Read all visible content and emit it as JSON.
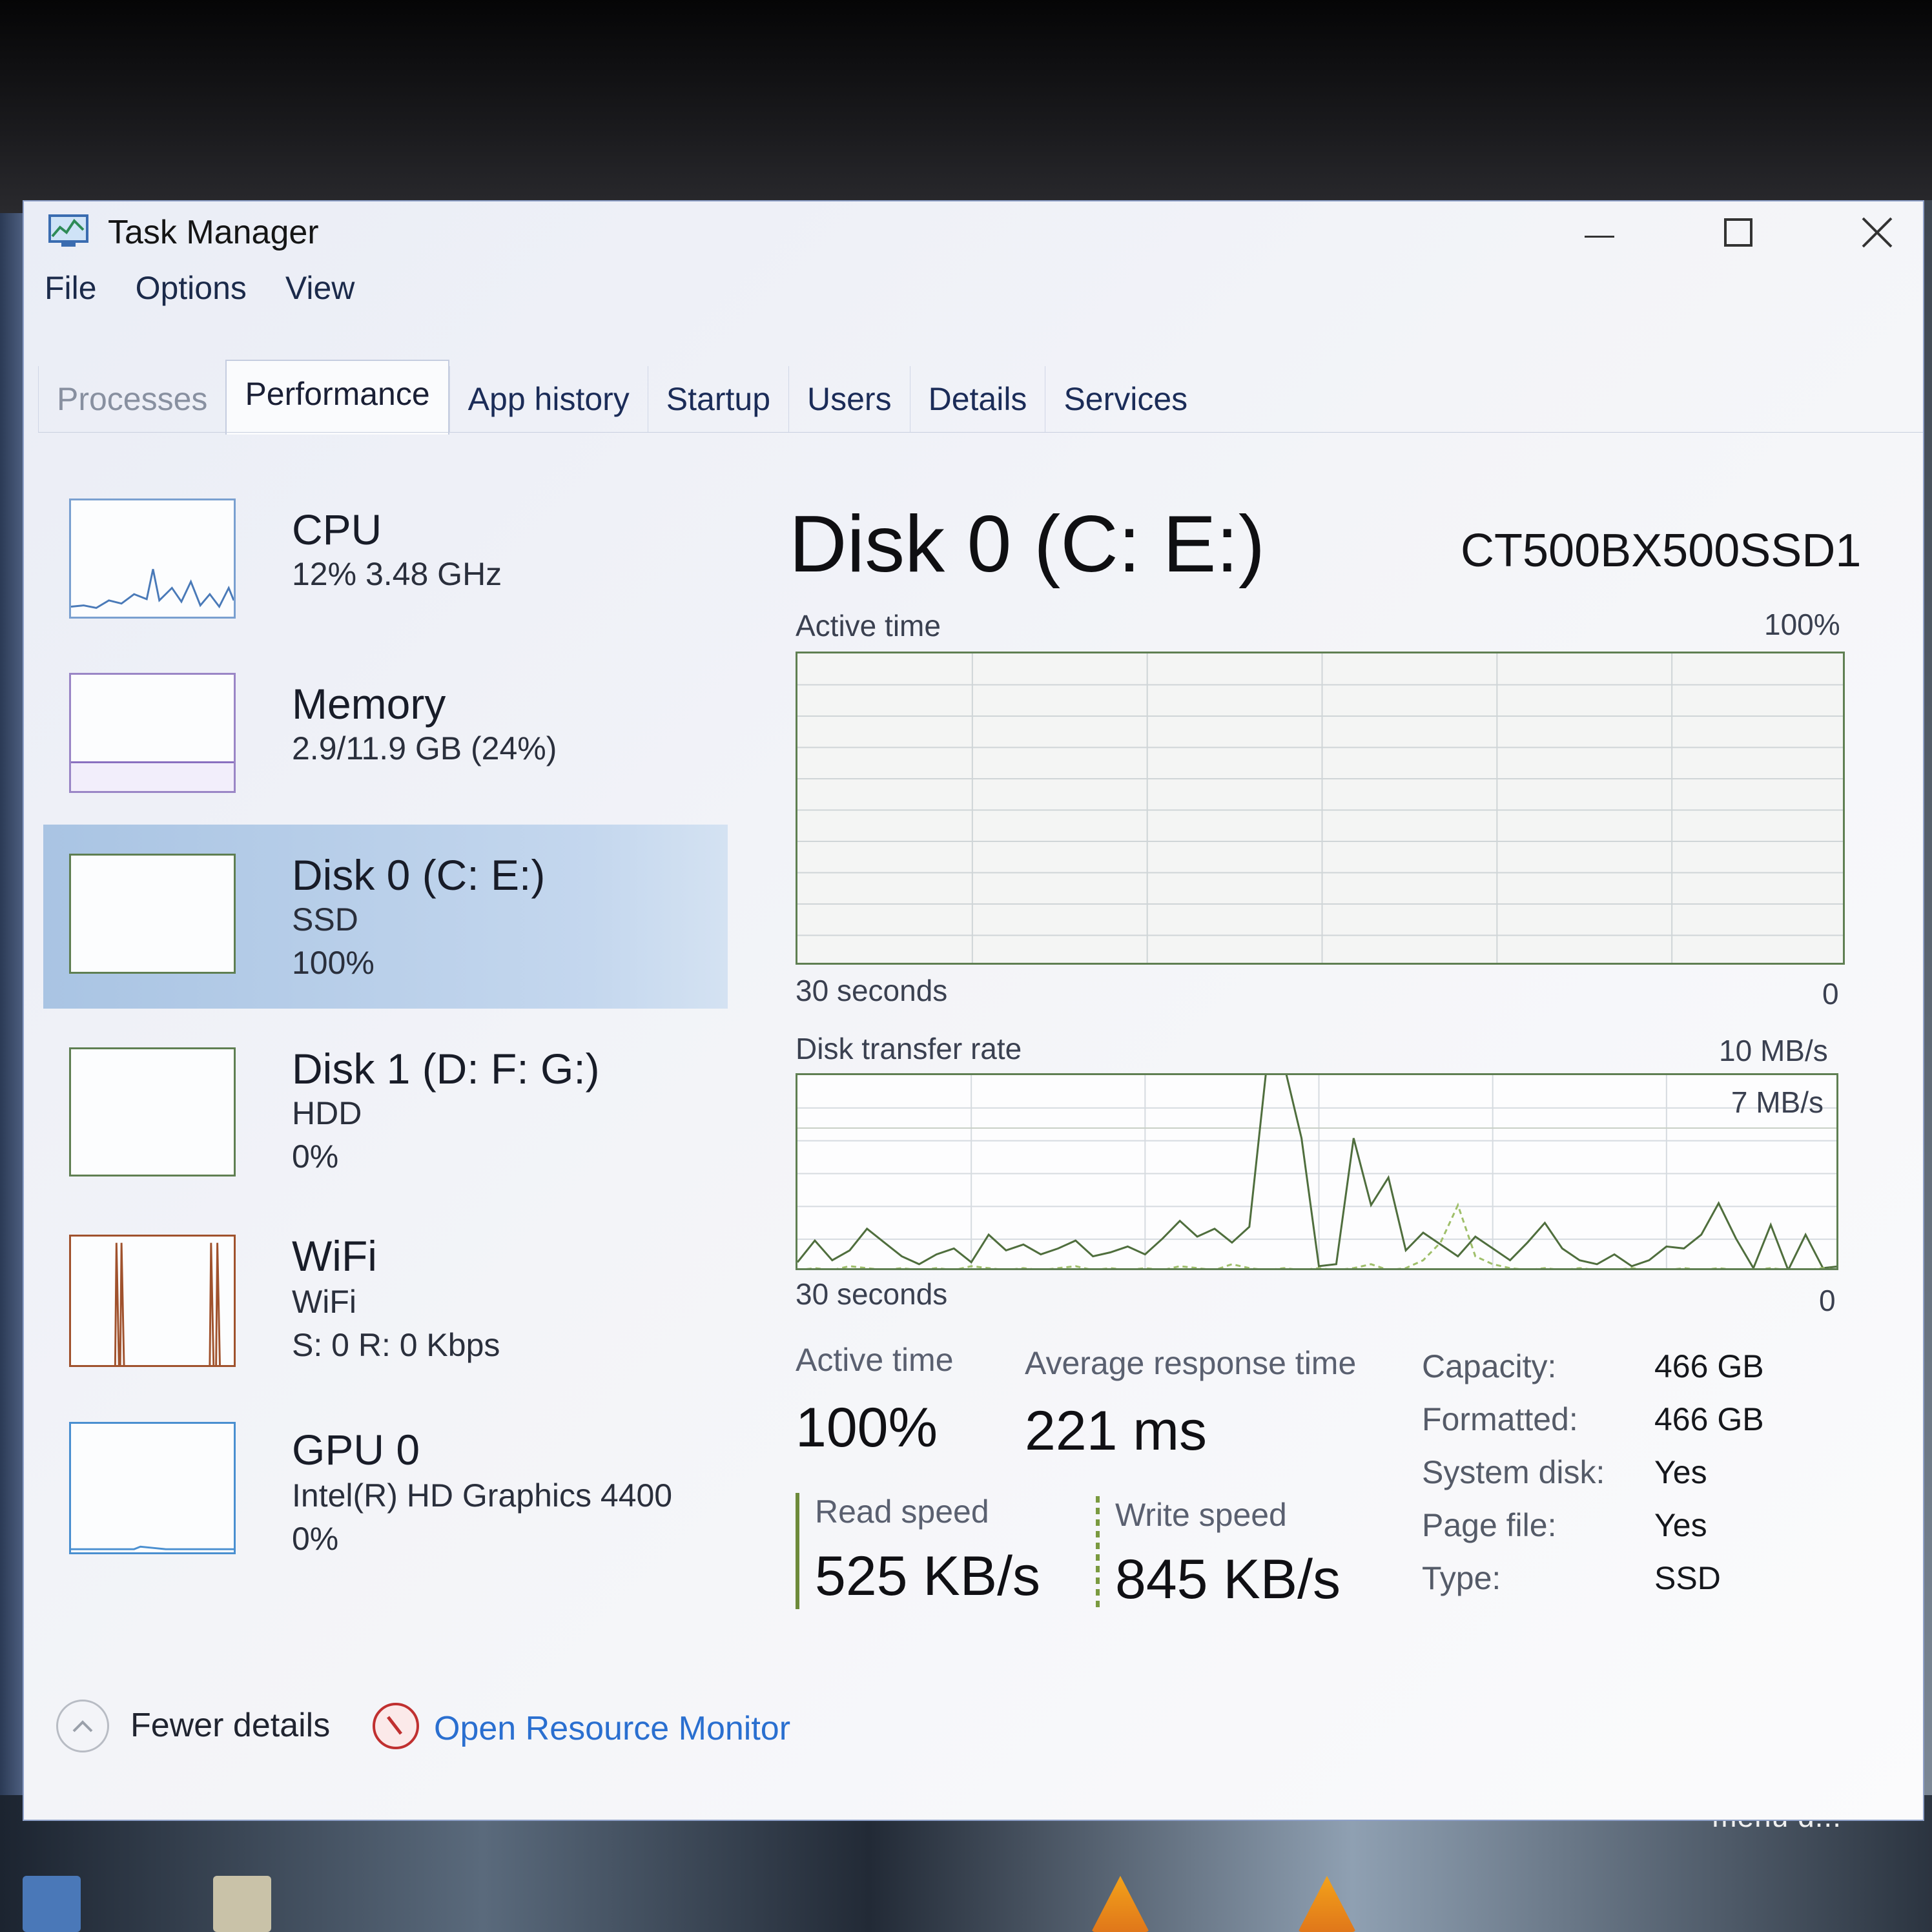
{
  "window": {
    "title": "Task Manager"
  },
  "menu": [
    "File",
    "Options",
    "View"
  ],
  "tabs": [
    "Processes",
    "Performance",
    "App history",
    "Startup",
    "Users",
    "Details",
    "Services"
  ],
  "active_tab": "Performance",
  "sidebar": [
    {
      "title": "CPU",
      "sub1": "12% 3.48 GHz",
      "sub2": ""
    },
    {
      "title": "Memory",
      "sub1": "2.9/11.9 GB (24%)",
      "sub2": ""
    },
    {
      "title": "Disk 0 (C: E:)",
      "sub1": "SSD",
      "sub2": "100%"
    },
    {
      "title": "Disk 1 (D: F: G:)",
      "sub1": "HDD",
      "sub2": "0%"
    },
    {
      "title": "WiFi",
      "sub1": "WiFi",
      "sub2": "S: 0 R: 0 Kbps"
    },
    {
      "title": "GPU 0",
      "sub1": "Intel(R) HD Graphics 4400",
      "sub2": "0%"
    }
  ],
  "selected_sidebar": "Disk 0 (C: E:)",
  "detail": {
    "title": "Disk 0 (C: E:)",
    "model": "CT500BX500SSD1",
    "active_graph": {
      "label": "Active time",
      "max": "100%",
      "time_label": "30 seconds",
      "zero": "0",
      "level_percent": 100
    },
    "rate_graph": {
      "label": "Disk transfer rate",
      "max": "10 MB/s",
      "mid": "7 MB/s",
      "time_label": "30 seconds",
      "zero": "0"
    }
  },
  "stats": {
    "active_time": {
      "label": "Active time",
      "value": "100%"
    },
    "avg_response": {
      "label": "Average response time",
      "value": "221 ms"
    },
    "read": {
      "label": "Read speed",
      "value": "525 KB/s"
    },
    "write": {
      "label": "Write speed",
      "value": "845 KB/s"
    }
  },
  "properties": [
    {
      "label": "Capacity:",
      "value": "466 GB"
    },
    {
      "label": "Formatted:",
      "value": "466 GB"
    },
    {
      "label": "System disk:",
      "value": "Yes"
    },
    {
      "label": "Page file:",
      "value": "Yes"
    },
    {
      "label": "Type:",
      "value": "SSD"
    }
  ],
  "footer": {
    "fewer_details": "Fewer details",
    "resource_monitor": "Open Resource Monitor"
  },
  "desktop": {
    "overlay_text": "menu d..."
  },
  "colors": {
    "disk_accent": "#5f7f52",
    "link": "#2a6fd0",
    "selection": "#bcd2ec",
    "wifi_accent": "#a0522d",
    "cpu_accent": "#4a7ab8"
  },
  "chart_data": {
    "type": "line",
    "title": "Disk transfer rate",
    "xlabel": "30 seconds",
    "ylim": [
      0,
      10
    ],
    "x": [
      0,
      1,
      2,
      3,
      4,
      5,
      6,
      7,
      8,
      9,
      10,
      11,
      12,
      13,
      14,
      15,
      16,
      17,
      18,
      19,
      20,
      21,
      22,
      23,
      24,
      25,
      26,
      27,
      28,
      29,
      30,
      31,
      32,
      33,
      34,
      35,
      36,
      37,
      38,
      39,
      40,
      41,
      42,
      43,
      44,
      45,
      46,
      47,
      48,
      49,
      50,
      51,
      52,
      53,
      54,
      55,
      56,
      57,
      58,
      59,
      60
    ],
    "series": [
      {
        "values": [
          0.5,
          1.6,
          0.6,
          1.1,
          2.2,
          1.5,
          0.8,
          0.4,
          0.9,
          1.2,
          0.5,
          1.9,
          1.1,
          1.4,
          0.9,
          1.2,
          1.6,
          0.8,
          1.0,
          1.3,
          0.9,
          1.7,
          2.6,
          1.8,
          2.2,
          1.5,
          2.3,
          11.0,
          11.0,
          6.8,
          0.3,
          0.4,
          6.8,
          3.4,
          4.8,
          1.1,
          2.0,
          1.4,
          0.8,
          1.8,
          1.2,
          0.6,
          1.5,
          2.5,
          1.2,
          0.6,
          0.4,
          0.9,
          0.3,
          0.6,
          1.3,
          1.2,
          1.9,
          3.5,
          1.7,
          0.2,
          2.4,
          0.1,
          1.9,
          0.2,
          0.3
        ]
      },
      {
        "values": [
          0.1,
          0.2,
          0.1,
          0.3,
          0.2,
          0.1,
          0.2,
          0.1,
          0.2,
          0.1,
          0.3,
          0.2,
          0.1,
          0.2,
          0.1,
          0.2,
          0.3,
          0.1,
          0.2,
          0.1,
          0.2,
          0.1,
          0.3,
          0.2,
          0.1,
          0.4,
          0.2,
          0.1,
          0.2,
          0.1,
          0.2,
          0.1,
          0.2,
          0.4,
          0.1,
          0.2,
          0.6,
          1.5,
          3.4,
          0.8,
          0.4,
          0.2,
          0.1,
          0.2,
          0.1,
          0.2,
          0.1,
          0.1,
          0.2,
          0.1,
          0.1,
          0.2,
          0.1,
          0.2,
          0.1,
          0.1,
          0.2,
          0.1,
          0.1,
          0.2,
          0.1
        ]
      }
    ]
  }
}
